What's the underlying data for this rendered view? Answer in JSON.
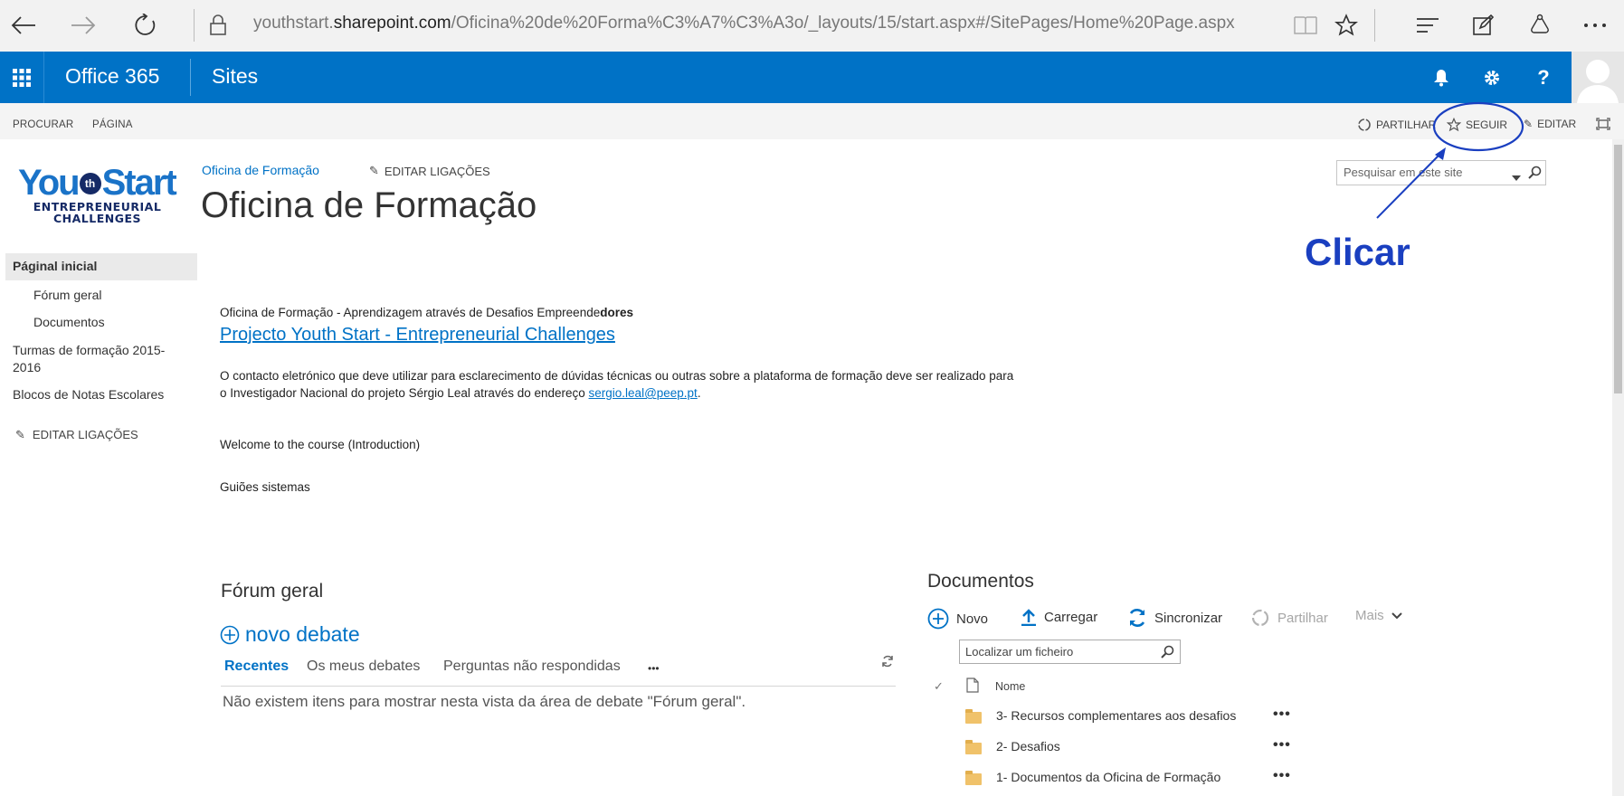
{
  "browser": {
    "url_prefix": "youthstart.",
    "url_domain": "sharepoint.com",
    "url_path": "/Oficina%20de%20Forma%C3%A7%C3%A3o/_layouts/15/start.aspx#/SitePages/Home%20Page.aspx"
  },
  "suite": {
    "app_name": "Office 365",
    "sites_label": "Sites"
  },
  "ribbon": {
    "tab_browse": "PROCURAR",
    "tab_page": "PÁGINA",
    "share": "PARTILHAR",
    "follow": "SEGUIR",
    "edit": "EDITAR"
  },
  "logo": {
    "you": "You",
    "th": "th",
    "start": "Start",
    "line1": "ENTREPRENEURIAL",
    "line2": "CHALLENGES"
  },
  "header": {
    "breadcrumb": "Oficina de Formação",
    "edit_links": "EDITAR LIGAÇÕES",
    "title": "Oficina de Formação",
    "search_placeholder": "Pesquisar em este site"
  },
  "nav": {
    "home": "Páginal inicial",
    "forum": "Fórum geral",
    "documents": "Documentos",
    "classes": "Turmas de formação 2015-2016",
    "notebooks": "Blocos de Notas Escolares",
    "edit_links": "EDITAR LIGAÇÕES"
  },
  "content": {
    "intro_prefix": "Oficina de Formação - Aprendizagem através de Desafios Empreende",
    "intro_bold": "dores",
    "project_link": "Projecto Youth Start - Entrepreneurial Challenges",
    "contact_line1": "O contacto eletrónico que deve utilizar para esclarecimento de dúvidas técnicas ou outras sobre a plataforma de formação deve ser realizado para",
    "contact_line2": "o Investigador Nacional do projeto Sérgio Leal através do endereço",
    "email": "sergio.leal@peep.pt",
    "email_suffix": ".",
    "welcome": "Welcome to the course (Introduction)",
    "guides": "Guiões sistemas"
  },
  "forum": {
    "title": "Fórum geral",
    "new_debate": "novo debate",
    "tab_recent": "Recentes",
    "tab_mine": "Os meus debates",
    "tab_unanswered": "Perguntas não respondidas",
    "tab_more": "•••",
    "empty_message": "Não existem itens para mostrar nesta vista da área de debate \"Fórum geral\"."
  },
  "documents": {
    "title": "Documentos",
    "new": "Novo",
    "upload": "Carregar",
    "sync": "Sincronizar",
    "share": "Partilhar",
    "more": "Mais",
    "find_placeholder": "Localizar um ficheiro",
    "col_name": "Nome",
    "rows": [
      {
        "name": "3- Recursos complementares aos desafios",
        "more": "•••"
      },
      {
        "name": "2- Desafios",
        "more": "•••"
      },
      {
        "name": "1- Documentos da Oficina de Formação",
        "more": "•••"
      }
    ]
  },
  "annotation": {
    "label": "Clicar",
    "color": "#1a3fc0"
  },
  "colors": {
    "suite_blue": "#0072c6",
    "link_blue": "#0072c6"
  }
}
